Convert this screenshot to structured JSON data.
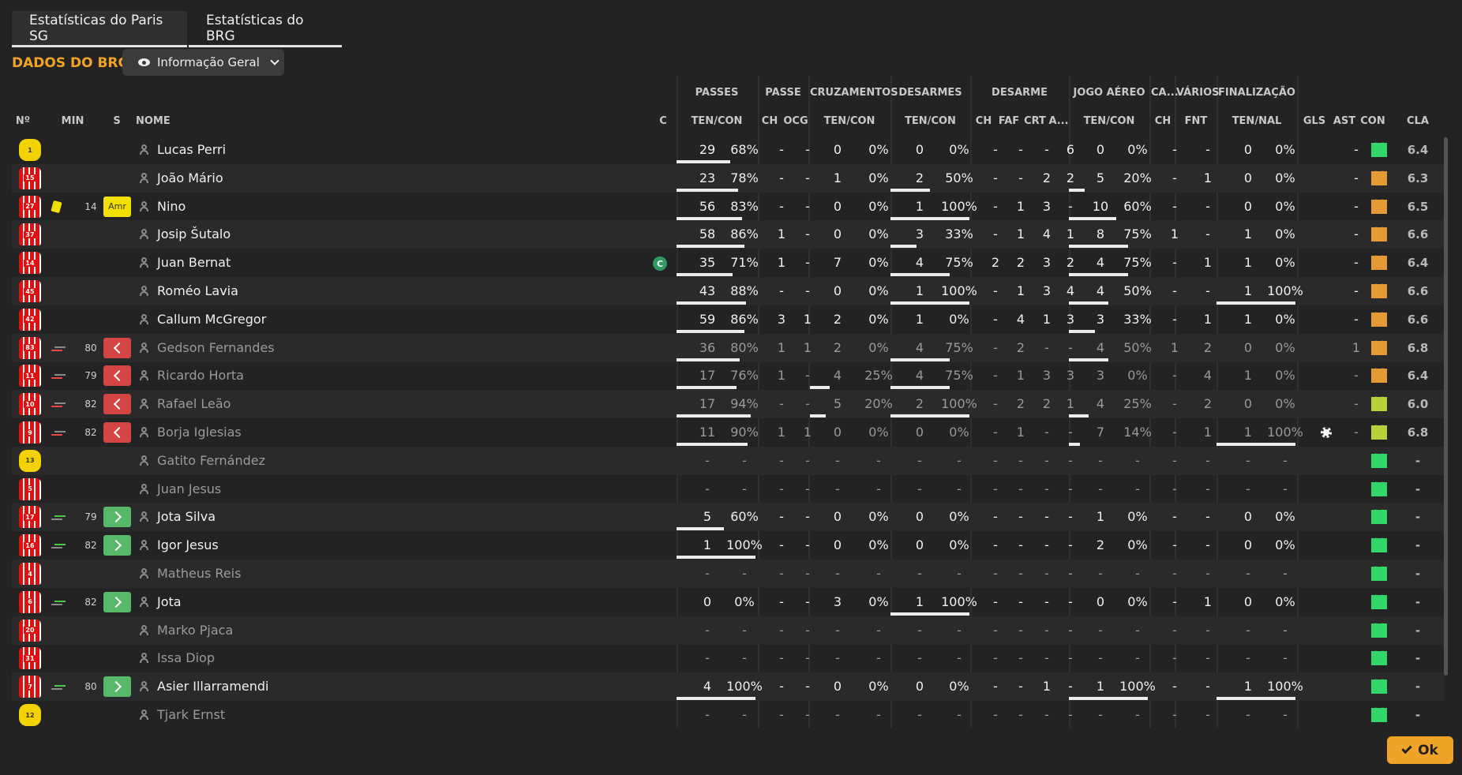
{
  "tabs": [
    {
      "label": "Estatísticas do Paris SG",
      "active": true
    },
    {
      "label": "Estatísticas do BRG",
      "active": false
    }
  ],
  "section_title": "DADOS DO BRG",
  "view_selector": {
    "label": "Informação Geral",
    "icon": "eye-icon"
  },
  "column_groups": [
    "PASSES",
    "PASSE",
    "CRUZAMENTOS",
    "DESARMES",
    "DESARME",
    "JOGO AÉREO",
    "CA...",
    "VÁRIOS",
    "FINALIZAÇÃO"
  ],
  "columns": [
    "Nº",
    "MIN",
    "S",
    "NOME",
    "C",
    "TEN/CON",
    "CH",
    "OCG",
    "TEN/CON",
    "TEN/CON",
    "CH",
    "FAF",
    "CRT",
    "A...",
    "TEN/CON",
    "CH",
    "FNT",
    "TEN/NAL",
    "GLS",
    "AST",
    "CON",
    "CLA"
  ],
  "players": [
    {
      "num": "1",
      "kit": "gk",
      "min": "",
      "sub": "",
      "name": "Lucas Perri",
      "c": "",
      "pa": "29",
      "pp": "68%",
      "pf": 0.68,
      "pch": "-",
      "ocg": "-",
      "cr": "0",
      "crp": "0%",
      "crf": 0,
      "de": "0",
      "dep": "0%",
      "def": 0,
      "dch": "-",
      "faf": "-",
      "crt": "-",
      "a": "6",
      "ja": "0",
      "jap": "0%",
      "jaf": 0,
      "ca": "-",
      "fnt": "-",
      "fi": "0",
      "fip": "0%",
      "fif": 0,
      "gls": "",
      "ast": "-",
      "con": "green",
      "cla": "6.4",
      "dim": false
    },
    {
      "num": "15",
      "kit": "red",
      "min": "",
      "sub": "",
      "name": "João Mário",
      "c": "",
      "pa": "23",
      "pp": "78%",
      "pf": 0.78,
      "pch": "-",
      "ocg": "-",
      "cr": "1",
      "crp": "0%",
      "crf": 0,
      "de": "2",
      "dep": "50%",
      "def": 0.5,
      "dch": "-",
      "faf": "-",
      "crt": "2",
      "a": "2",
      "ja": "5",
      "jap": "20%",
      "jaf": 0.2,
      "ca": "-",
      "fnt": "1",
      "fi": "0",
      "fip": "0%",
      "fif": 0,
      "gls": "",
      "ast": "-",
      "con": "orange",
      "cla": "6.3",
      "dim": false
    },
    {
      "num": "27",
      "kit": "red",
      "min": "14",
      "sub": "amr",
      "subtext": "Amr",
      "card": true,
      "name": "Nino",
      "c": "",
      "pa": "56",
      "pp": "83%",
      "pf": 0.83,
      "pch": "-",
      "ocg": "-",
      "cr": "0",
      "crp": "0%",
      "crf": 0,
      "de": "1",
      "dep": "100%",
      "def": 1,
      "dch": "-",
      "faf": "1",
      "crt": "3",
      "a": "-",
      "ja": "10",
      "jap": "60%",
      "jaf": 0.6,
      "ca": "-",
      "fnt": "-",
      "fi": "0",
      "fip": "0%",
      "fif": 0,
      "gls": "",
      "ast": "-",
      "con": "orange",
      "cla": "6.5",
      "dim": false
    },
    {
      "num": "37",
      "kit": "red",
      "min": "",
      "sub": "",
      "name": "Josip Šutalo",
      "c": "",
      "pa": "58",
      "pp": "86%",
      "pf": 0.86,
      "pch": "1",
      "ocg": "-",
      "cr": "0",
      "crp": "0%",
      "crf": 0,
      "de": "3",
      "dep": "33%",
      "def": 0.33,
      "dch": "-",
      "faf": "1",
      "crt": "4",
      "a": "1",
      "ja": "8",
      "jap": "75%",
      "jaf": 0.75,
      "ca": "1",
      "fnt": "-",
      "fi": "1",
      "fip": "0%",
      "fif": 0,
      "gls": "",
      "ast": "-",
      "con": "orange",
      "cla": "6.6",
      "dim": false
    },
    {
      "num": "14",
      "kit": "red",
      "min": "",
      "sub": "",
      "name": "Juan Bernat",
      "c": "C",
      "pa": "35",
      "pp": "71%",
      "pf": 0.71,
      "pch": "1",
      "ocg": "-",
      "cr": "7",
      "crp": "0%",
      "crf": 0,
      "de": "4",
      "dep": "75%",
      "def": 0.75,
      "dch": "2",
      "faf": "2",
      "crt": "3",
      "a": "2",
      "ja": "4",
      "jap": "75%",
      "jaf": 0.75,
      "ca": "-",
      "fnt": "1",
      "fi": "1",
      "fip": "0%",
      "fif": 0,
      "gls": "",
      "ast": "-",
      "con": "orange",
      "cla": "6.4",
      "dim": false
    },
    {
      "num": "45",
      "kit": "red",
      "min": "",
      "sub": "",
      "name": "Roméo Lavia",
      "c": "",
      "pa": "43",
      "pp": "88%",
      "pf": 0.88,
      "pch": "-",
      "ocg": "-",
      "cr": "0",
      "crp": "0%",
      "crf": 0,
      "de": "1",
      "dep": "100%",
      "def": 1,
      "dch": "-",
      "faf": "1",
      "crt": "3",
      "a": "4",
      "ja": "4",
      "jap": "50%",
      "jaf": 0.5,
      "ca": "-",
      "fnt": "-",
      "fi": "1",
      "fip": "100%",
      "fif": 1,
      "gls": "",
      "ast": "-",
      "con": "orange",
      "cla": "6.6",
      "dim": false
    },
    {
      "num": "42",
      "kit": "red",
      "min": "",
      "sub": "",
      "name": "Callum McGregor",
      "c": "",
      "pa": "59",
      "pp": "86%",
      "pf": 0.86,
      "pch": "3",
      "ocg": "1",
      "cr": "2",
      "crp": "0%",
      "crf": 0,
      "de": "1",
      "dep": "0%",
      "def": 0,
      "dch": "-",
      "faf": "4",
      "crt": "1",
      "a": "3",
      "ja": "3",
      "jap": "33%",
      "jaf": 0.33,
      "ca": "-",
      "fnt": "1",
      "fi": "1",
      "fip": "0%",
      "fif": 0,
      "gls": "",
      "ast": "-",
      "con": "orange",
      "cla": "6.6",
      "dim": false
    },
    {
      "num": "83",
      "kit": "red",
      "min": "80",
      "sub": "off",
      "name": "Gedson Fernandes",
      "c": "",
      "pa": "36",
      "pp": "80%",
      "pf": 0.8,
      "pch": "1",
      "ocg": "1",
      "cr": "2",
      "crp": "0%",
      "crf": 0,
      "de": "4",
      "dep": "75%",
      "def": 0.75,
      "dch": "-",
      "faf": "2",
      "crt": "-",
      "a": "-",
      "ja": "4",
      "jap": "50%",
      "jaf": 0.5,
      "ca": "1",
      "fnt": "2",
      "fi": "0",
      "fip": "0%",
      "fif": 0,
      "gls": "",
      "ast": "1",
      "con": "orange",
      "cla": "6.8",
      "dim": true
    },
    {
      "num": "11",
      "kit": "red",
      "min": "79",
      "sub": "off",
      "name": "Ricardo Horta",
      "c": "",
      "pa": "17",
      "pp": "76%",
      "pf": 0.76,
      "pch": "1",
      "ocg": "-",
      "cr": "4",
      "crp": "25%",
      "crf": 0.25,
      "de": "4",
      "dep": "75%",
      "def": 0.75,
      "dch": "-",
      "faf": "1",
      "crt": "3",
      "a": "3",
      "ja": "3",
      "jap": "0%",
      "jaf": 0,
      "ca": "-",
      "fnt": "4",
      "fi": "1",
      "fip": "0%",
      "fif": 0,
      "gls": "",
      "ast": "-",
      "con": "orange",
      "cla": "6.4",
      "dim": true
    },
    {
      "num": "10",
      "kit": "red",
      "min": "82",
      "sub": "off",
      "name": "Rafael Leão",
      "c": "",
      "pa": "17",
      "pp": "94%",
      "pf": 0.94,
      "pch": "-",
      "ocg": "-",
      "cr": "5",
      "crp": "20%",
      "crf": 0.2,
      "de": "2",
      "dep": "100%",
      "def": 1,
      "dch": "-",
      "faf": "2",
      "crt": "2",
      "a": "1",
      "ja": "4",
      "jap": "25%",
      "jaf": 0.25,
      "ca": "-",
      "fnt": "2",
      "fi": "0",
      "fip": "0%",
      "fif": 0,
      "gls": "",
      "ast": "-",
      "con": "yellow",
      "cla": "6.0",
      "dim": true
    },
    {
      "num": "9",
      "kit": "red",
      "min": "82",
      "sub": "off",
      "name": "Borja Iglesias",
      "c": "",
      "pa": "11",
      "pp": "90%",
      "pf": 0.9,
      "pch": "1",
      "ocg": "1",
      "cr": "0",
      "crp": "0%",
      "crf": 0,
      "de": "0",
      "dep": "0%",
      "def": 0,
      "dch": "-",
      "faf": "1",
      "crt": "-",
      "a": "-",
      "ja": "7",
      "jap": "14%",
      "jaf": 0.14,
      "ca": "-",
      "fnt": "1",
      "fi": "1",
      "fip": "100%",
      "fif": 1,
      "gls": "ball",
      "ast": "-",
      "con": "yellow",
      "cla": "6.8",
      "dim": true
    },
    {
      "num": "13",
      "kit": "gk",
      "min": "",
      "sub": "",
      "name": "Gatito Fernández",
      "c": "",
      "pa": "-",
      "pp": "-",
      "pf": 0,
      "pch": "-",
      "ocg": "-",
      "cr": "-",
      "crp": "-",
      "crf": 0,
      "de": "-",
      "dep": "-",
      "def": 0,
      "dch": "-",
      "faf": "-",
      "crt": "-",
      "a": "-",
      "ja": "-",
      "jap": "-",
      "jaf": 0,
      "ca": "-",
      "fnt": "-",
      "fi": "-",
      "fip": "-",
      "fif": 0,
      "gls": "",
      "ast": "",
      "con": "green",
      "cla": "-",
      "dim": true
    },
    {
      "num": "5",
      "kit": "red",
      "min": "",
      "sub": "",
      "name": "Juan Jesus",
      "c": "",
      "pa": "-",
      "pp": "-",
      "pf": 0,
      "pch": "-",
      "ocg": "-",
      "cr": "-",
      "crp": "-",
      "crf": 0,
      "de": "-",
      "dep": "-",
      "def": 0,
      "dch": "-",
      "faf": "-",
      "crt": "-",
      "a": "-",
      "ja": "-",
      "jap": "-",
      "jaf": 0,
      "ca": "-",
      "fnt": "-",
      "fi": "-",
      "fip": "-",
      "fif": 0,
      "gls": "",
      "ast": "",
      "con": "green",
      "cla": "-",
      "dim": true
    },
    {
      "num": "17",
      "kit": "red",
      "min": "79",
      "sub": "on",
      "name": "Jota Silva",
      "c": "",
      "pa": "5",
      "pp": "60%",
      "pf": 0.6,
      "pch": "-",
      "ocg": "-",
      "cr": "0",
      "crp": "0%",
      "crf": 0,
      "de": "0",
      "dep": "0%",
      "def": 0,
      "dch": "-",
      "faf": "-",
      "crt": "-",
      "a": "-",
      "ja": "1",
      "jap": "0%",
      "jaf": 0,
      "ca": "-",
      "fnt": "-",
      "fi": "0",
      "fip": "0%",
      "fif": 0,
      "gls": "",
      "ast": "",
      "con": "green",
      "cla": "-",
      "dim": false
    },
    {
      "num": "16",
      "kit": "red",
      "min": "82",
      "sub": "on",
      "name": "Igor Jesus",
      "c": "",
      "pa": "1",
      "pp": "100%",
      "pf": 1,
      "pch": "-",
      "ocg": "-",
      "cr": "0",
      "crp": "0%",
      "crf": 0,
      "de": "0",
      "dep": "0%",
      "def": 0,
      "dch": "-",
      "faf": "-",
      "crt": "-",
      "a": "-",
      "ja": "2",
      "jap": "0%",
      "jaf": 0,
      "ca": "-",
      "fnt": "-",
      "fi": "0",
      "fip": "0%",
      "fif": 0,
      "gls": "",
      "ast": "",
      "con": "green",
      "cla": "-",
      "dim": false
    },
    {
      "num": "4",
      "kit": "red",
      "min": "",
      "sub": "",
      "name": "Matheus Reis",
      "c": "",
      "pa": "-",
      "pp": "-",
      "pf": 0,
      "pch": "-",
      "ocg": "-",
      "cr": "-",
      "crp": "-",
      "crf": 0,
      "de": "-",
      "dep": "-",
      "def": 0,
      "dch": "-",
      "faf": "-",
      "crt": "-",
      "a": "-",
      "ja": "-",
      "jap": "-",
      "jaf": 0,
      "ca": "-",
      "fnt": "-",
      "fi": "-",
      "fip": "-",
      "fif": 0,
      "gls": "",
      "ast": "",
      "con": "green",
      "cla": "-",
      "dim": true
    },
    {
      "num": "6",
      "kit": "red",
      "min": "82",
      "sub": "on",
      "name": "Jota",
      "c": "",
      "pa": "0",
      "pp": "0%",
      "pf": 0,
      "pch": "-",
      "ocg": "-",
      "cr": "3",
      "crp": "0%",
      "crf": 0,
      "de": "1",
      "dep": "100%",
      "def": 1,
      "dch": "-",
      "faf": "-",
      "crt": "-",
      "a": "-",
      "ja": "0",
      "jap": "0%",
      "jaf": 0,
      "ca": "-",
      "fnt": "1",
      "fi": "0",
      "fip": "0%",
      "fif": 0,
      "gls": "",
      "ast": "",
      "con": "green",
      "cla": "-",
      "dim": false
    },
    {
      "num": "20",
      "kit": "red",
      "min": "",
      "sub": "",
      "name": "Marko Pjaca",
      "c": "",
      "pa": "-",
      "pp": "-",
      "pf": 0,
      "pch": "-",
      "ocg": "-",
      "cr": "-",
      "crp": "-",
      "crf": 0,
      "de": "-",
      "dep": "-",
      "def": 0,
      "dch": "-",
      "faf": "-",
      "crt": "-",
      "a": "-",
      "ja": "-",
      "jap": "-",
      "jaf": 0,
      "ca": "-",
      "fnt": "-",
      "fi": "-",
      "fip": "-",
      "fif": 0,
      "gls": "",
      "ast": "",
      "con": "green",
      "cla": "-",
      "dim": true
    },
    {
      "num": "31",
      "kit": "red",
      "min": "",
      "sub": "",
      "name": "Issa Diop",
      "c": "",
      "pa": "-",
      "pp": "-",
      "pf": 0,
      "pch": "-",
      "ocg": "-",
      "cr": "-",
      "crp": "-",
      "crf": 0,
      "de": "-",
      "dep": "-",
      "def": 0,
      "dch": "-",
      "faf": "-",
      "crt": "-",
      "a": "-",
      "ja": "-",
      "jap": "-",
      "jaf": 0,
      "ca": "-",
      "fnt": "-",
      "fi": "-",
      "fip": "-",
      "fif": 0,
      "gls": "",
      "ast": "",
      "con": "green",
      "cla": "-",
      "dim": true
    },
    {
      "num": "7",
      "kit": "red",
      "min": "80",
      "sub": "on",
      "name": "Asier Illarramendi",
      "c": "",
      "pa": "4",
      "pp": "100%",
      "pf": 1,
      "pch": "-",
      "ocg": "-",
      "cr": "0",
      "crp": "0%",
      "crf": 0,
      "de": "0",
      "dep": "0%",
      "def": 0,
      "dch": "-",
      "faf": "-",
      "crt": "1",
      "a": "-",
      "ja": "1",
      "jap": "100%",
      "jaf": 1,
      "ca": "-",
      "fnt": "-",
      "fi": "1",
      "fip": "100%",
      "fif": 1,
      "gls": "",
      "ast": "",
      "con": "green",
      "cla": "-",
      "dim": false
    },
    {
      "num": "12",
      "kit": "gk",
      "min": "",
      "sub": "",
      "name": "Tjark Ernst",
      "c": "",
      "pa": "-",
      "pp": "-",
      "pf": 0,
      "pch": "-",
      "ocg": "-",
      "cr": "-",
      "crp": "-",
      "crf": 0,
      "de": "-",
      "dep": "-",
      "def": 0,
      "dch": "-",
      "faf": "-",
      "crt": "-",
      "a": "-",
      "ja": "-",
      "jap": "-",
      "jaf": 0,
      "ca": "-",
      "fnt": "-",
      "fi": "-",
      "fip": "-",
      "fif": 0,
      "gls": "",
      "ast": "",
      "con": "green",
      "cla": "-",
      "dim": true
    }
  ],
  "ok_button": {
    "label": "Ok"
  },
  "colors": {
    "accent": "#f0a427",
    "background": "#232323"
  }
}
